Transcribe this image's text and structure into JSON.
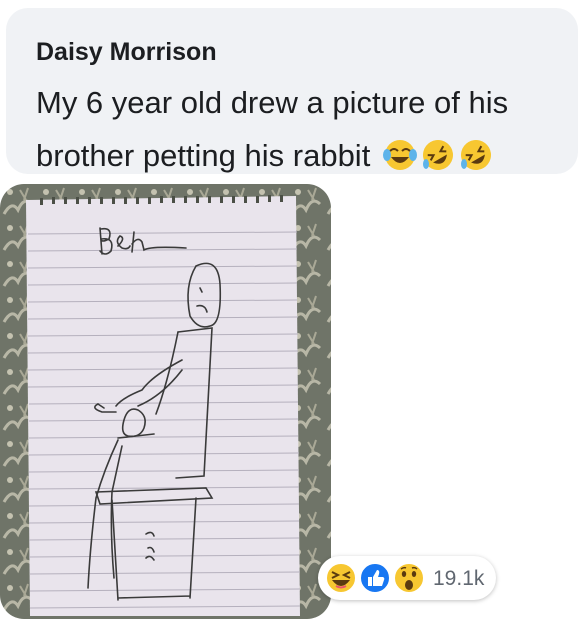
{
  "post": {
    "author": "Daisy Morrison",
    "text": "My 6 year old drew a picture of his brother petting his rabbit",
    "emojis": [
      "tears-of-joy-emoji",
      "rolling-laughing-emoji",
      "rolling-laughing-emoji"
    ]
  },
  "drawing": {
    "caption": "Ben",
    "description_icons": [
      "stick-figure-boy",
      "rabbit",
      "chair"
    ]
  },
  "reactions": {
    "icons": [
      "haha-reaction-icon",
      "like-reaction-icon",
      "wow-reaction-icon"
    ],
    "count": "19.1k"
  },
  "colors": {
    "bubble_bg": "#f0f2f5",
    "text": "#1c1e21",
    "like_blue": "#1877f2",
    "emoji_yellow": "#f7c731",
    "count_gray": "#606770"
  }
}
